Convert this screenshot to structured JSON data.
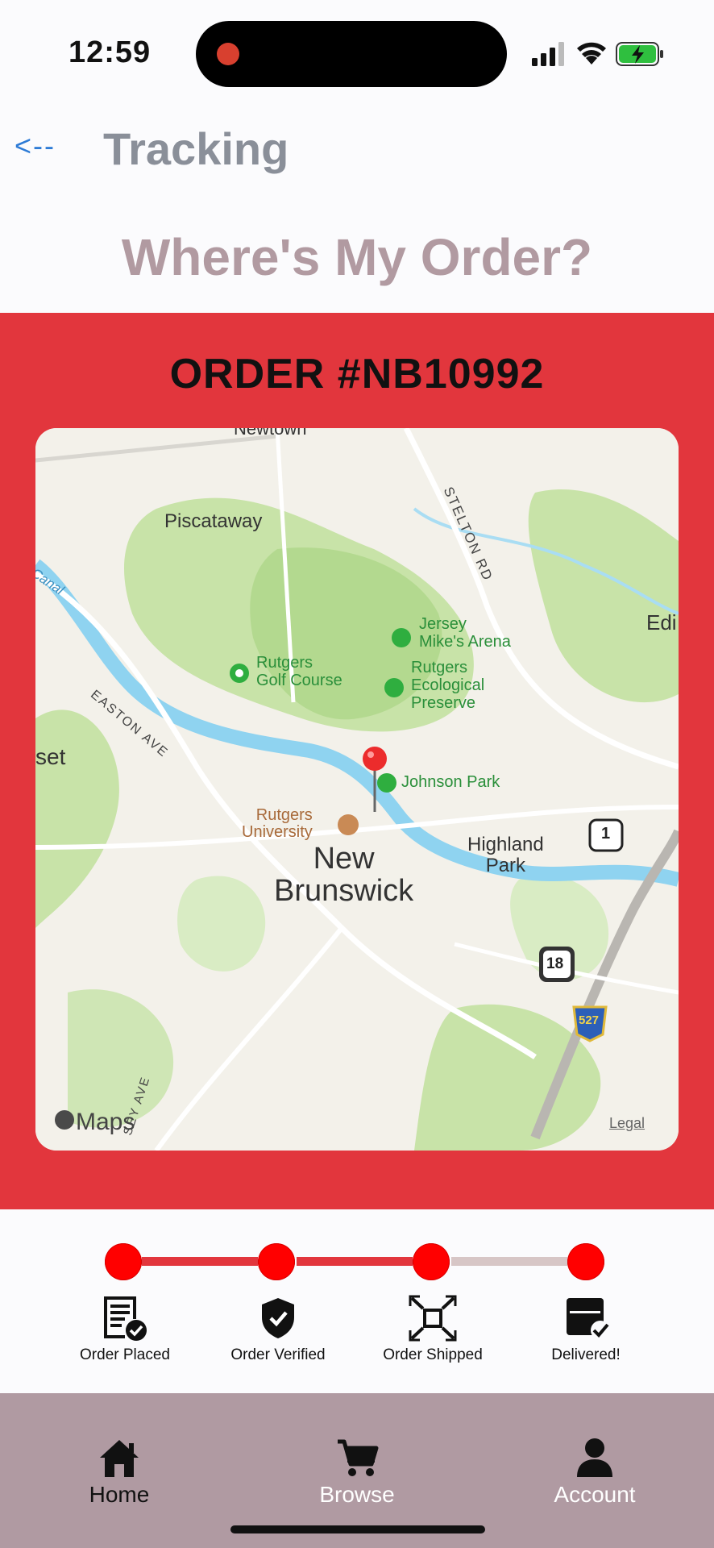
{
  "status_bar": {
    "time": "12:59"
  },
  "header": {
    "back_label": "<--",
    "title": "Tracking"
  },
  "page_heading": "Where's My Order?",
  "order": {
    "number_label": "ORDER #NB10992"
  },
  "map": {
    "labels": {
      "newtown": "Newtown",
      "piscataway": "Piscataway",
      "stelton": "STELTON RD",
      "canal": "Canal",
      "edison": "Edi",
      "jersey_mikes": "Jersey\nMike's Arena",
      "rutgers_golf": "Rutgers\nGolf Course",
      "eco_preserve": "Rutgers\nEcological\nPreserve",
      "easton": "EASTON AVE",
      "somerset": "set",
      "johnson_park": "Johnson Park",
      "rutgers_univ": "Rutgers\nUniversity",
      "new_brunswick": "New\nBrunswick",
      "highland_park": "Highland\nPark",
      "route_1": "1",
      "route_18": "18",
      "route_527": "527",
      "maps_brand": "Maps",
      "legal": "Legal",
      "sey_ave": "SEY AVE"
    }
  },
  "progress": {
    "steps": [
      {
        "label": "Order Placed",
        "icon": "receipt-check-icon",
        "complete": true
      },
      {
        "label": "Order Verified",
        "icon": "shield-check-icon",
        "complete": true
      },
      {
        "label": "Order Shipped",
        "icon": "package-shipped-icon",
        "complete": true
      },
      {
        "label": "Delivered!",
        "icon": "box-check-icon",
        "complete": true
      }
    ],
    "connector_colors": [
      "#e2363d",
      "#e2363d",
      "#d7c6c6"
    ]
  },
  "nav": {
    "items": [
      {
        "label": "Home",
        "icon": "home-icon",
        "active": true
      },
      {
        "label": "Browse",
        "icon": "cart-icon",
        "active": false
      },
      {
        "label": "Account",
        "icon": "person-icon",
        "active": false
      }
    ]
  },
  "colors": {
    "accent": "#e2363d",
    "nav_bg": "#b09aa2",
    "heading": "#b19aa1",
    "step_dot": "#ff0000"
  }
}
